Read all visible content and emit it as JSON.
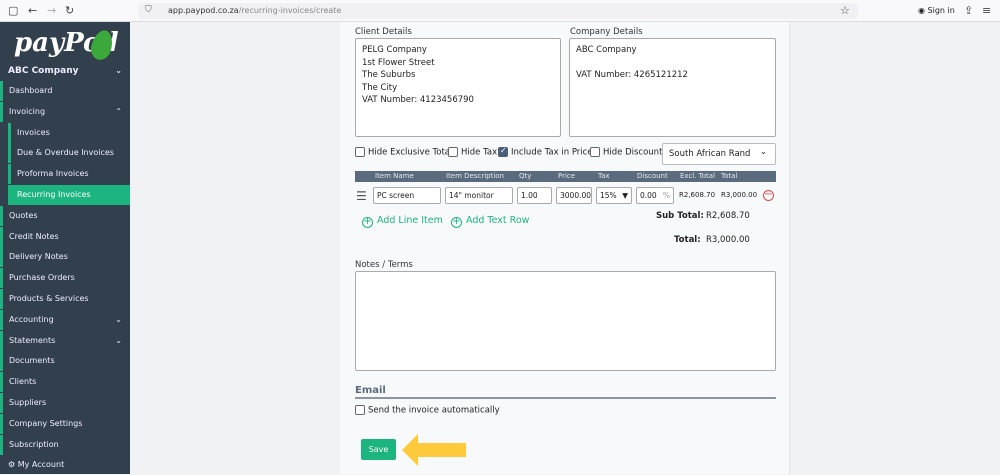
{
  "browser": {
    "url_host": "app.paypod.co.za",
    "url_path": "/recurring-invoices/create",
    "sign_in": "Sign in"
  },
  "sidebar": {
    "logo": "payPod",
    "company": "ABC Company",
    "items": [
      {
        "label": "Dashboard"
      },
      {
        "label": "Invoicing"
      },
      {
        "label": "Invoices"
      },
      {
        "label": "Due & Overdue Invoices"
      },
      {
        "label": "Proforma Invoices"
      },
      {
        "label": "Recurring Invoices"
      },
      {
        "label": "Quotes"
      },
      {
        "label": "Credit Notes"
      },
      {
        "label": "Delivery Notes"
      },
      {
        "label": "Purchase Orders"
      },
      {
        "label": "Products & Services"
      },
      {
        "label": "Accounting"
      },
      {
        "label": "Statements"
      },
      {
        "label": "Documents"
      },
      {
        "label": "Clients"
      },
      {
        "label": "Suppliers"
      },
      {
        "label": "Company Settings"
      },
      {
        "label": "Subscription"
      },
      {
        "label": "My Account"
      }
    ]
  },
  "form": {
    "client_label": "Client Details",
    "client_text": "PELG Company\n1st Flower Street\nThe Suburbs\nThe City\nVAT Number: 4123456790",
    "company_label": "Company Details",
    "company_text": "ABC Company\n\nVAT Number: 4265121212",
    "options": {
      "hide_excl": "Hide Exclusive Total",
      "hide_tax": "Hide Tax",
      "incl_tax": "Include Tax in Price",
      "hide_discount": "Hide Discount",
      "currency": "South African Rand"
    },
    "columns": [
      "Item Name",
      "Item Description",
      "Qty",
      "Price",
      "Tax",
      "Discount",
      "Excl. Total",
      "Total"
    ],
    "row": {
      "name": "PC screen",
      "desc": "14\" monitor",
      "qty": "1.00",
      "price": "3000.00",
      "tax": "15%",
      "discount": "0.00",
      "pct": "%",
      "excl": "R2,608.70",
      "total": "R3,000.00"
    },
    "add_line": "Add Line Item",
    "add_text": "Add Text Row",
    "subtotal_label": "Sub Total:",
    "subtotal": "R2,608.70",
    "total_label": "Total:",
    "total": "R3,000.00",
    "notes_label": "Notes / Terms",
    "email_heading": "Email",
    "send_auto": "Send the invoice automatically",
    "save": "Save"
  }
}
